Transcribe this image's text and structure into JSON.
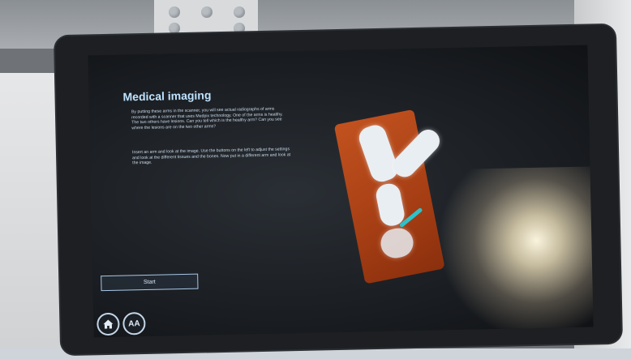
{
  "screen": {
    "title": "Medical imaging",
    "paragraph_1": "By putting these arms in the scanner, you will see actual radiographs of arms recorded with a scanner that uses Medpix technology. One of the arms is healthy. The two others have lesions. Can you tell which is the healthy arm? Can you see where the lesions are on the two other arms?",
    "paragraph_2": "Insert an arm and look at the image. Use the buttons on the left to adjust the settings and look at the different tissues and the bones. Now put in a different arm and look at the image.",
    "start_label": "Start",
    "text_size_label": "AA"
  },
  "icons": {
    "home": "home-icon"
  },
  "colors": {
    "screen_bg": "#181b1f",
    "title": "#bfe2ff",
    "scan_tissue": "#b84a1a",
    "probe": "#2dc2c9"
  }
}
